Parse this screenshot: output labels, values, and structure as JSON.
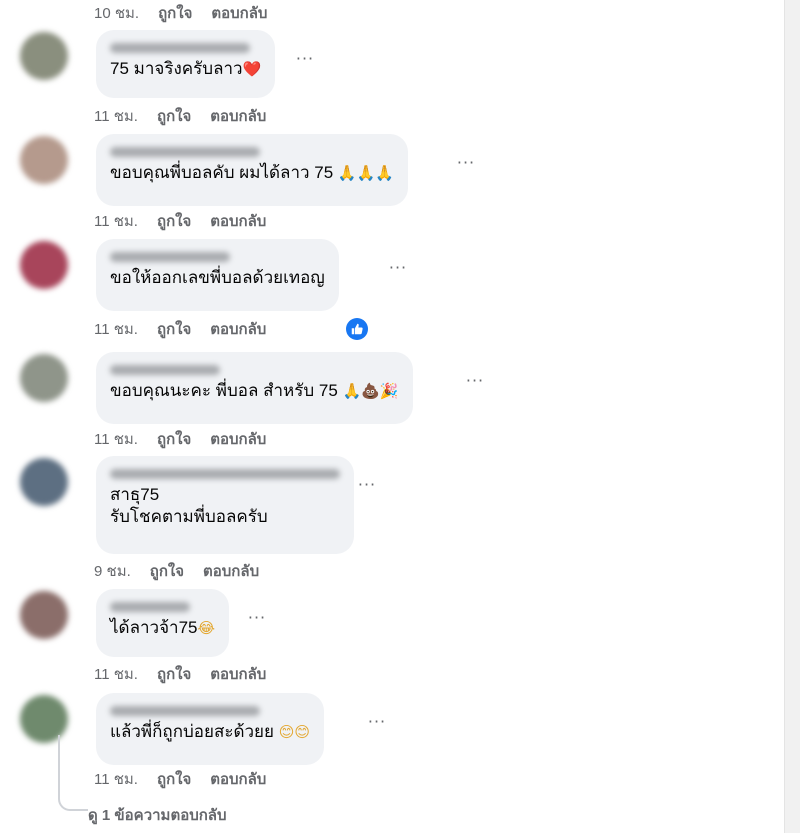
{
  "colors": {
    "bubble": "#f0f2f5",
    "meta_text": "#65676b",
    "like_blue": "#1877f2",
    "heart_red": "#e41e3f"
  },
  "top_meta": {
    "time": "10 ชม.",
    "like": "ถูกใจ",
    "reply": "ตอบกลับ"
  },
  "comments": [
    {
      "lines": [
        "75 มาจริงครับลาว"
      ],
      "emoji": "❤️",
      "time": "11 ชม.",
      "like": "ถูกใจ",
      "reply": "ตอบกลับ"
    },
    {
      "lines": [
        "ขอบคุณพี่บอลคับ ผมได้ลาว 75"
      ],
      "emoji": "🙏🙏🙏",
      "time": "11 ชม.",
      "like": "ถูกใจ",
      "reply": "ตอบกลับ"
    },
    {
      "lines": [
        "ขอให้ออกเลขพี่บอลด้วยเทอญ"
      ],
      "emoji": "",
      "time": "11 ชม.",
      "like": "ถูกใจ",
      "reply": "ตอบกลับ",
      "reaction_icon": "like-icon"
    },
    {
      "lines": [
        "ขอบคุณนะคะ พี่บอล สำหรับ 75"
      ],
      "emoji": "🙏💩🎉",
      "time": "11 ชม.",
      "like": "ถูกใจ",
      "reply": "ตอบกลับ"
    },
    {
      "lines": [
        "สาธุ75",
        "รับโชคตามพี่บอลครับ"
      ],
      "emoji": "",
      "time": "9 ชม.",
      "like": "ถูกใจ",
      "reply": "ตอบกลับ"
    },
    {
      "lines": [
        "ได้ลาวจ้า75"
      ],
      "emoji": "😂",
      "time": "11 ชม.",
      "like": "ถูกใจ",
      "reply": "ตอบกลับ"
    },
    {
      "lines": [
        "แล้วพี่ก็ถูกบ่อยสะด้วยย"
      ],
      "emoji": "😊😊",
      "time": "11 ชม.",
      "like": "ถูกใจ",
      "reply": "ตอบกลับ"
    }
  ],
  "more_icon": "more-horizontal-icon",
  "view_replies": "ดู 1 ข้อความตอบกลับ"
}
